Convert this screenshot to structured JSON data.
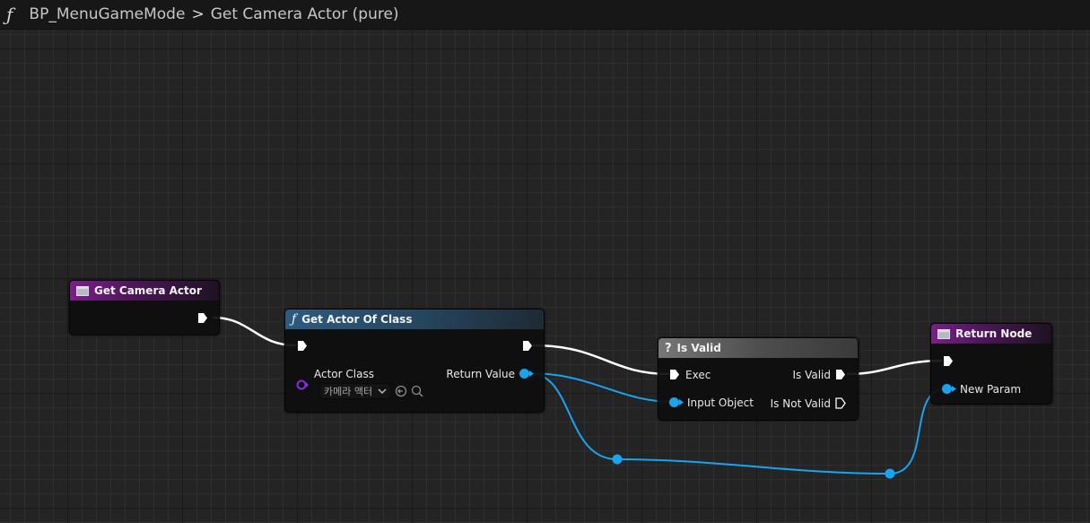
{
  "breadcrumb": {
    "function_icon": "ƒ",
    "blueprint": "BP_MenuGameMode",
    "separator": ">",
    "function_name": "Get Camera Actor (pure)"
  },
  "nodes": {
    "entry": {
      "title": "Get Camera Actor",
      "icon": "function-entry-icon"
    },
    "get_actor_of_class": {
      "title": "Get Actor Of Class",
      "icon_glyph": "ƒ",
      "actor_class_label": "Actor Class",
      "actor_class_value": "카메라 액터",
      "return_value_label": "Return Value"
    },
    "is_valid": {
      "title": "Is Valid",
      "icon_glyph": "?",
      "exec_label": "Exec",
      "input_object_label": "Input Object",
      "is_valid_label": "Is Valid",
      "is_not_valid_label": "Is Not Valid"
    },
    "return_node": {
      "title": "Return Node",
      "new_param_label": "New Param"
    }
  },
  "colors": {
    "exec_wire": "#ffffff",
    "object_wire": "#1aa3ef",
    "class_pin": "#8b2be2",
    "entry_header": "#7a1f8a",
    "function_header": "#2c5b80",
    "macro_header": "#777777"
  }
}
